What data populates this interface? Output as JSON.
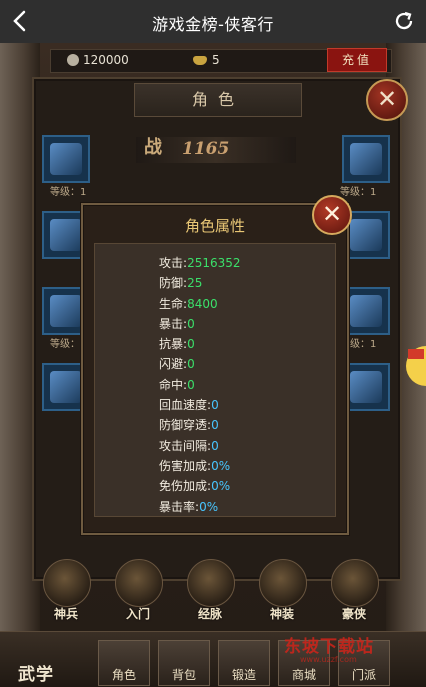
{
  "nav": {
    "title": "游戏金榜-侠客行"
  },
  "currency": {
    "silver": "120000",
    "gold": "5",
    "recharge_label": "充值"
  },
  "role_panel": {
    "title": "角色",
    "power_char": "战",
    "power_value": "1165",
    "level_label": "等级：1"
  },
  "modal": {
    "title": "角色属性",
    "close_label": "✕",
    "stats": [
      {
        "label": "攻击",
        "value": "2516352",
        "color": "green"
      },
      {
        "label": "防御",
        "value": "25",
        "color": "green"
      },
      {
        "label": "生命",
        "value": "8400",
        "color": "green"
      },
      {
        "label": "暴击",
        "value": "0",
        "color": "green"
      },
      {
        "label": "抗暴",
        "value": "0",
        "color": "green"
      },
      {
        "label": "闪避",
        "value": "0",
        "color": "green"
      },
      {
        "label": "命中",
        "value": "0",
        "color": "green"
      },
      {
        "label": "回血速度",
        "value": "0",
        "color": "cyan"
      },
      {
        "label": "防御穿透",
        "value": "0",
        "color": "cyan"
      },
      {
        "label": "攻击间隔",
        "value": "0",
        "color": "cyan"
      },
      {
        "label": "伤害加成",
        "value": "0%",
        "color": "cyan"
      },
      {
        "label": "免伤加成",
        "value": "0%",
        "color": "cyan"
      },
      {
        "label": "暴击率",
        "value": "0%",
        "color": "cyan"
      }
    ]
  },
  "menu": {
    "items": [
      "神兵",
      "入门",
      "经脉",
      "神装",
      "豪侠"
    ]
  },
  "bottom_tabs": {
    "wuxue": "武学",
    "items": [
      "角色",
      "背包",
      "锻造",
      "商城",
      "门派"
    ]
  },
  "watermark": {
    "text": "东坡下载站",
    "sub": "www.uzzf.com"
  },
  "colors": {
    "stat_green": "#3be06a",
    "stat_cyan": "#48c6ff",
    "title_gold": "#e8c675"
  }
}
